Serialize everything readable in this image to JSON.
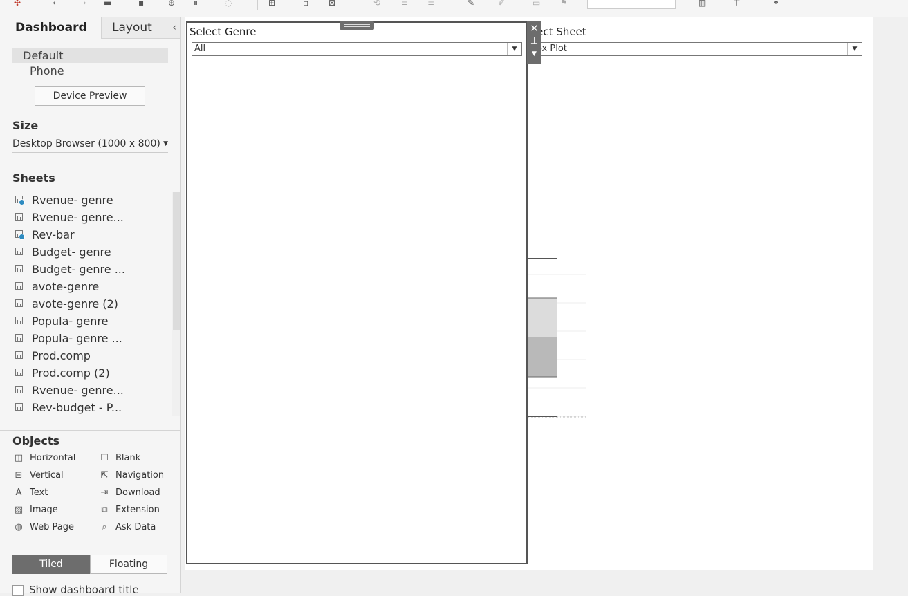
{
  "left_panel": {
    "tabs": {
      "dashboard": "Dashboard",
      "layout": "Layout"
    },
    "collapse_glyph": "‹",
    "devices": {
      "default": "Default",
      "phone": "Phone"
    },
    "device_preview": "Device Preview",
    "size": {
      "title": "Size",
      "value": "Desktop Browser (1000 x 800)"
    },
    "sheets": {
      "title": "Sheets",
      "items": [
        {
          "label": "Rvenue- genre",
          "used": true
        },
        {
          "label": "Rvenue- genre...",
          "used": false
        },
        {
          "label": "Rev-bar",
          "used": true
        },
        {
          "label": "Budget- genre",
          "used": false
        },
        {
          "label": "Budget- genre ...",
          "used": false
        },
        {
          "label": "avote-genre",
          "used": false
        },
        {
          "label": "avote-genre (2)",
          "used": false
        },
        {
          "label": "Popula- genre",
          "used": false
        },
        {
          "label": "Popula- genre ...",
          "used": false
        },
        {
          "label": "Prod.comp",
          "used": false
        },
        {
          "label": "Prod.comp (2)",
          "used": false
        },
        {
          "label": "Rvenue- genre...",
          "used": false
        },
        {
          "label": "Rev-budget - P...",
          "used": false
        }
      ]
    },
    "objects": {
      "title": "Objects",
      "horizontal": "Horizontal",
      "vertical": "Vertical",
      "text": "Text",
      "image": "Image",
      "web_page": "Web Page",
      "blank": "Blank",
      "navigation": "Navigation",
      "download": "Download",
      "extension": "Extension",
      "ask_data": "Ask Data"
    },
    "layout_mode": {
      "tiled": "Tiled",
      "floating": "Floating"
    },
    "show_title": "Show dashboard title"
  },
  "canvas": {
    "genre_filter": {
      "label": "Select Genre",
      "value": "All"
    },
    "sheet_filter": {
      "label": "lect Sheet",
      "value": "ox Plot"
    },
    "boxplot": {
      "upper_whisker": 1.0,
      "q3": 0.75,
      "median": 0.5,
      "q1": 0.25,
      "lower_whisker": 0.0
    }
  }
}
